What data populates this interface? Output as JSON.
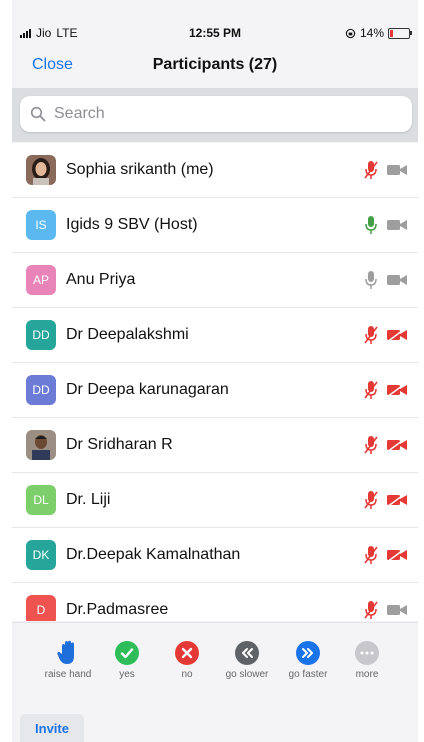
{
  "status_bar": {
    "carrier": "Jio",
    "network": "LTE",
    "time": "12:55 PM",
    "battery_text": "14%",
    "battery_level": 0.14,
    "battery_color": "#e53935"
  },
  "nav": {
    "close_label": "Close",
    "title": "Participants (27)"
  },
  "search": {
    "placeholder": "Search"
  },
  "colors": {
    "mic_muted": "#e53935",
    "video_off": "#e53935",
    "mic_active": "#43a047",
    "icon_gray": "#9e9e9e",
    "link_blue": "#1a73e8"
  },
  "participants": [
    {
      "name": "Sophia srikanth (me)",
      "initials": "",
      "avatar": "photo-woman",
      "mic": "muted",
      "video": "on"
    },
    {
      "name": "Igids 9 SBV (Host)",
      "initials": "IS",
      "avatar_color": "#5bb8f0",
      "mic": "speaking",
      "video": "on"
    },
    {
      "name": "Anu Priya",
      "initials": "AP",
      "avatar_color": "#e884b8",
      "mic": "on",
      "video": "on"
    },
    {
      "name": "Dr  Deepalakshmi",
      "initials": "DD",
      "avatar_color": "#26a69a",
      "mic": "muted",
      "video": "off"
    },
    {
      "name": "Dr Deepa karunagaran",
      "initials": "DD",
      "avatar_color": "#6b7bd6",
      "mic": "muted",
      "video": "off"
    },
    {
      "name": "Dr Sridharan R",
      "initials": "",
      "avatar": "photo-man",
      "mic": "muted",
      "video": "off"
    },
    {
      "name": "Dr. Liji",
      "initials": "DL",
      "avatar_color": "#7ccf6a",
      "mic": "muted",
      "video": "off"
    },
    {
      "name": "Dr.Deepak Kamalnathan",
      "initials": "DK",
      "avatar_color": "#26a69a",
      "mic": "muted",
      "video": "off"
    },
    {
      "name": "Dr.Padmasree",
      "initials": "D",
      "avatar_color": "#ef5350",
      "mic": "muted",
      "video": "on"
    }
  ],
  "reactions": [
    {
      "label": "raise hand",
      "icon": "raised-hand-icon",
      "color": "#1e6fd9"
    },
    {
      "label": "yes",
      "icon": "check-icon",
      "color": "#2ebd59"
    },
    {
      "label": "no",
      "icon": "x-icon",
      "color": "#e53935"
    },
    {
      "label": "go slower",
      "icon": "rewind-icon",
      "color": "#5f6368"
    },
    {
      "label": "go faster",
      "icon": "fast-forward-icon",
      "color": "#1a73e8"
    },
    {
      "label": "more",
      "icon": "more-dots-icon",
      "color": "#c7c7cc"
    }
  ],
  "footer": {
    "invite_label": "Invite"
  }
}
